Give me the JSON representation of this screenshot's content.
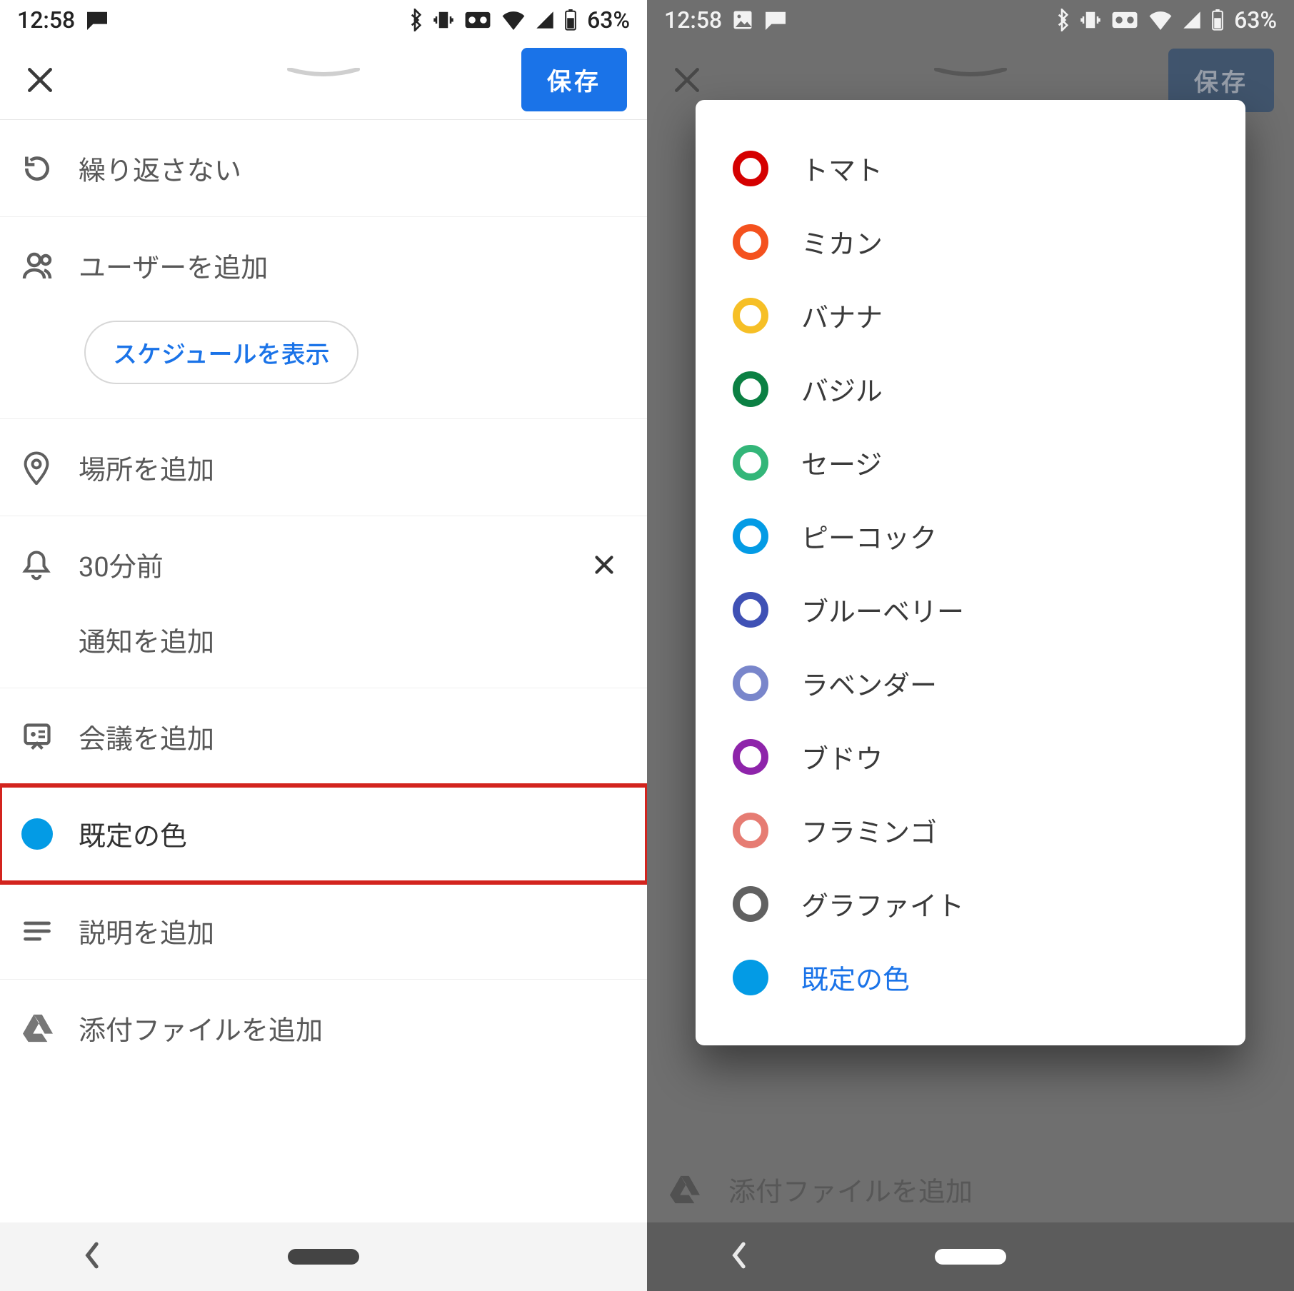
{
  "status": {
    "time": "12:58",
    "battery": "63%"
  },
  "appbar": {
    "save_label": "保存"
  },
  "rows": {
    "repeat": "繰り返さない",
    "add_user": "ユーザーを追加",
    "show_schedule": "スケジュールを表示",
    "add_location": "場所を追加",
    "reminder": "30分前",
    "add_notification": "通知を追加",
    "add_meeting": "会議を追加",
    "default_color": "既定の色",
    "add_description": "説明を追加",
    "add_attachment": "添付ファイルを追加"
  },
  "picker": {
    "items": [
      {
        "label": "トマト",
        "hex": "#d50000"
      },
      {
        "label": "ミカン",
        "hex": "#f4511e"
      },
      {
        "label": "バナナ",
        "hex": "#f6bf26"
      },
      {
        "label": "バジル",
        "hex": "#0b8043"
      },
      {
        "label": "セージ",
        "hex": "#33b679"
      },
      {
        "label": "ピーコック",
        "hex": "#039be5"
      },
      {
        "label": "ブルーベリー",
        "hex": "#3f51b5"
      },
      {
        "label": "ラベンダー",
        "hex": "#7986cb"
      },
      {
        "label": "ブドウ",
        "hex": "#8e24aa"
      },
      {
        "label": "フラミンゴ",
        "hex": "#e67c73"
      },
      {
        "label": "グラファイト",
        "hex": "#616161"
      }
    ],
    "default_label": "既定の色",
    "default_hex": "#039be5"
  }
}
